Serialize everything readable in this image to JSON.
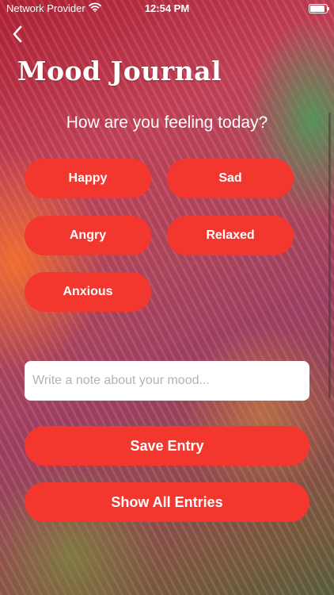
{
  "status_bar": {
    "carrier": "Network Provider",
    "time": "12:54 PM",
    "icons": [
      "wifi-icon",
      "battery-icon"
    ]
  },
  "nav": {
    "back_icon": "chevron-left-icon"
  },
  "header": {
    "title": "Mood Journal"
  },
  "prompt": "How are you feeling today?",
  "moods": [
    "Happy",
    "Sad",
    "Angry",
    "Relaxed",
    "Anxious"
  ],
  "note": {
    "value": "",
    "placeholder": "Write a note about your mood..."
  },
  "actions": {
    "save_label": "Save Entry",
    "show_all_label": "Show All Entries"
  },
  "colors": {
    "accent": "#f4372e",
    "field_bg": "#ffffff",
    "text": "#ffffff"
  }
}
